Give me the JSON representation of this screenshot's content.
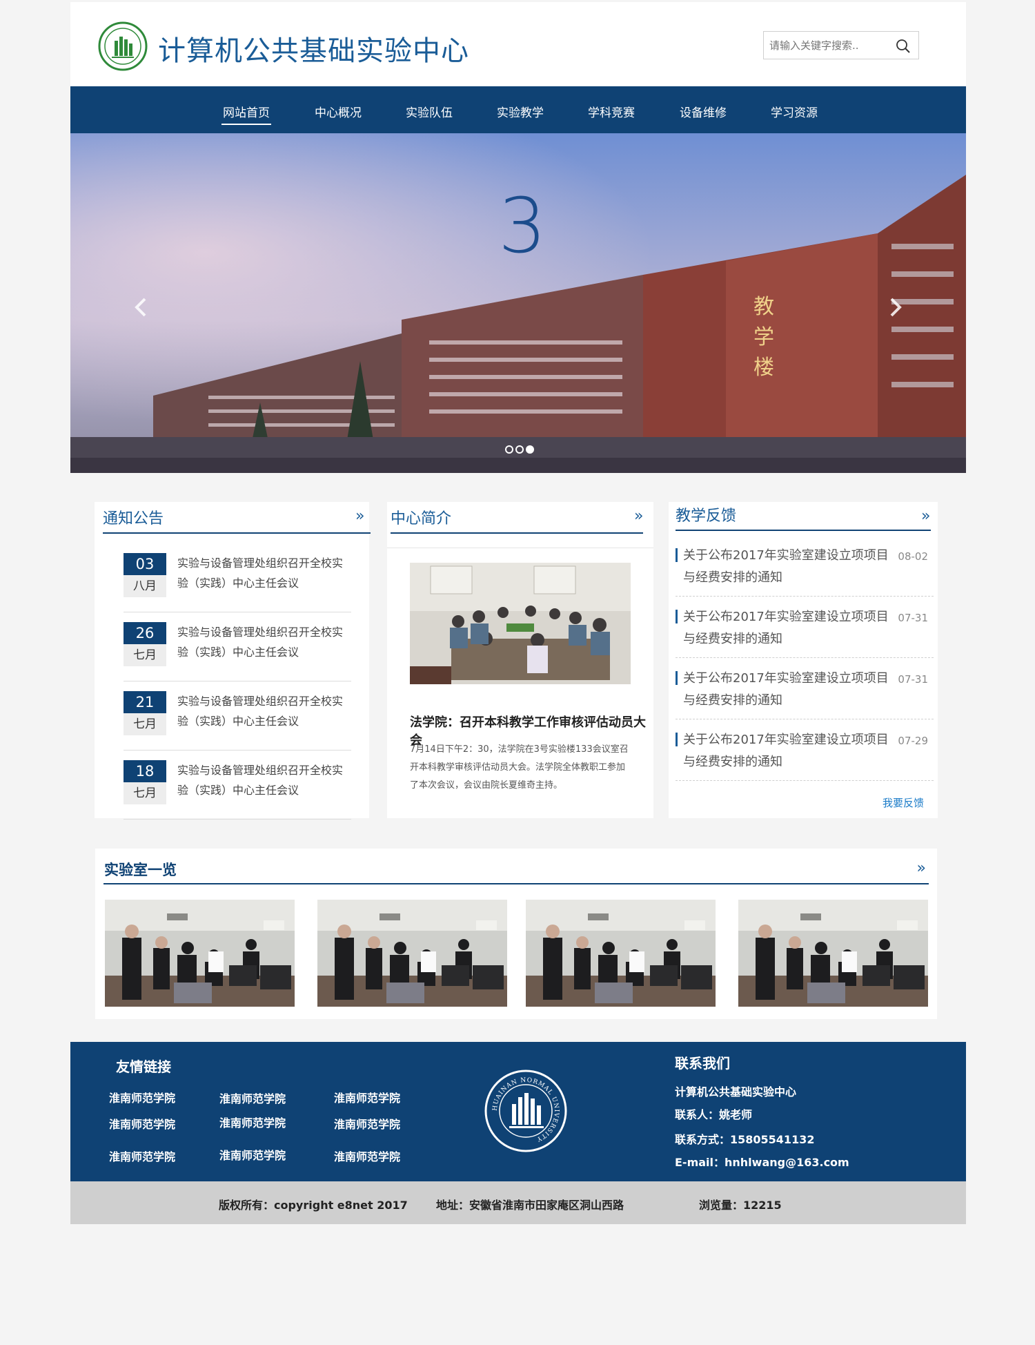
{
  "header": {
    "site_title": "计算机公共基础实验中心",
    "search_placeholder": "请输入关键字搜索..",
    "logo_icon": "university-seal-icon",
    "search_icon": "search-icon"
  },
  "nav": {
    "items": [
      {
        "label": "网站首页",
        "active": true
      },
      {
        "label": "中心概况"
      },
      {
        "label": "实验队伍"
      },
      {
        "label": "实验教学"
      },
      {
        "label": "学科竞赛"
      },
      {
        "label": "设备维修"
      },
      {
        "label": "学习资源"
      }
    ]
  },
  "banner": {
    "slide_number": "3",
    "building_sign": [
      "教",
      "学",
      "楼"
    ],
    "prev_icon": "chevron-left-icon",
    "next_icon": "chevron-right-icon",
    "slide_count": 3,
    "active_slide": 3
  },
  "notices": {
    "title": "通知公告",
    "more": "»",
    "items": [
      {
        "day": "03",
        "month": "八月",
        "text": "实验与设备管理处组织召开全校实验（实践）中心主任会议"
      },
      {
        "day": "26",
        "month": "七月",
        "text": "实验与设备管理处组织召开全校实验（实践）中心主任会议"
      },
      {
        "day": "21",
        "month": "七月",
        "text": "实验与设备管理处组织召开全校实验（实践）中心主任会议"
      },
      {
        "day": "18",
        "month": "七月",
        "text": "实验与设备管理处组织召开全校实验（实践）中心主任会议"
      }
    ]
  },
  "intro": {
    "title": "中心简介",
    "more": "»",
    "headline": "法学院：召开本科教学工作审核评估动员大会",
    "body": "7月14日下午2：30，法学院在3号实验楼133会议室召开本科教学审核评估动员大会。法学院全体教职工参加了本次会议，会议由院长夏维奇主持。"
  },
  "feedback": {
    "title": "教学反馈",
    "more": "»",
    "items": [
      {
        "text": "关于公布2017年实验室建设立项项目与经费安排的通知",
        "date": "08-02"
      },
      {
        "text": "关于公布2017年实验室建设立项项目与经费安排的通知",
        "date": "07-31"
      },
      {
        "text": "关于公布2017年实验室建设立项项目与经费安排的通知",
        "date": "07-31"
      },
      {
        "text": "关于公布2017年实验室建设立项项目与经费安排的通知",
        "date": "07-29"
      }
    ],
    "link": "我要反馈"
  },
  "labs": {
    "title": "实验室一览",
    "more": "»",
    "count": 4
  },
  "footer": {
    "links_title": "友情链接",
    "links": [
      "淮南师范学院",
      "淮南师范学院",
      "淮南师范学院",
      "淮南师范学院",
      "淮南师范学院",
      "淮南师范学院",
      "淮南师范学院",
      "淮南师范学院",
      "淮南师范学院"
    ],
    "seal_text": "HUAINAN NORMAL UNIVERSITY",
    "seal_cn": "淮南师范学院",
    "contact_title": "联系我们",
    "contact": [
      "计算机公共基础实验中心",
      "联系人：姚老师",
      "联系方式：15805541132",
      "E-mail：hnhlwang@163.com"
    ]
  },
  "copyright": {
    "copy": "版权所有：copyright e8net 2017",
    "address": "地址：安徽省淮南市田家庵区洞山西路",
    "views": "浏览量：12215"
  },
  "colors": {
    "primary": "#0f4274",
    "title_blue": "#1a5c97",
    "footer_gray": "#cfcfcf",
    "page_bg": "#f4f4f4"
  }
}
